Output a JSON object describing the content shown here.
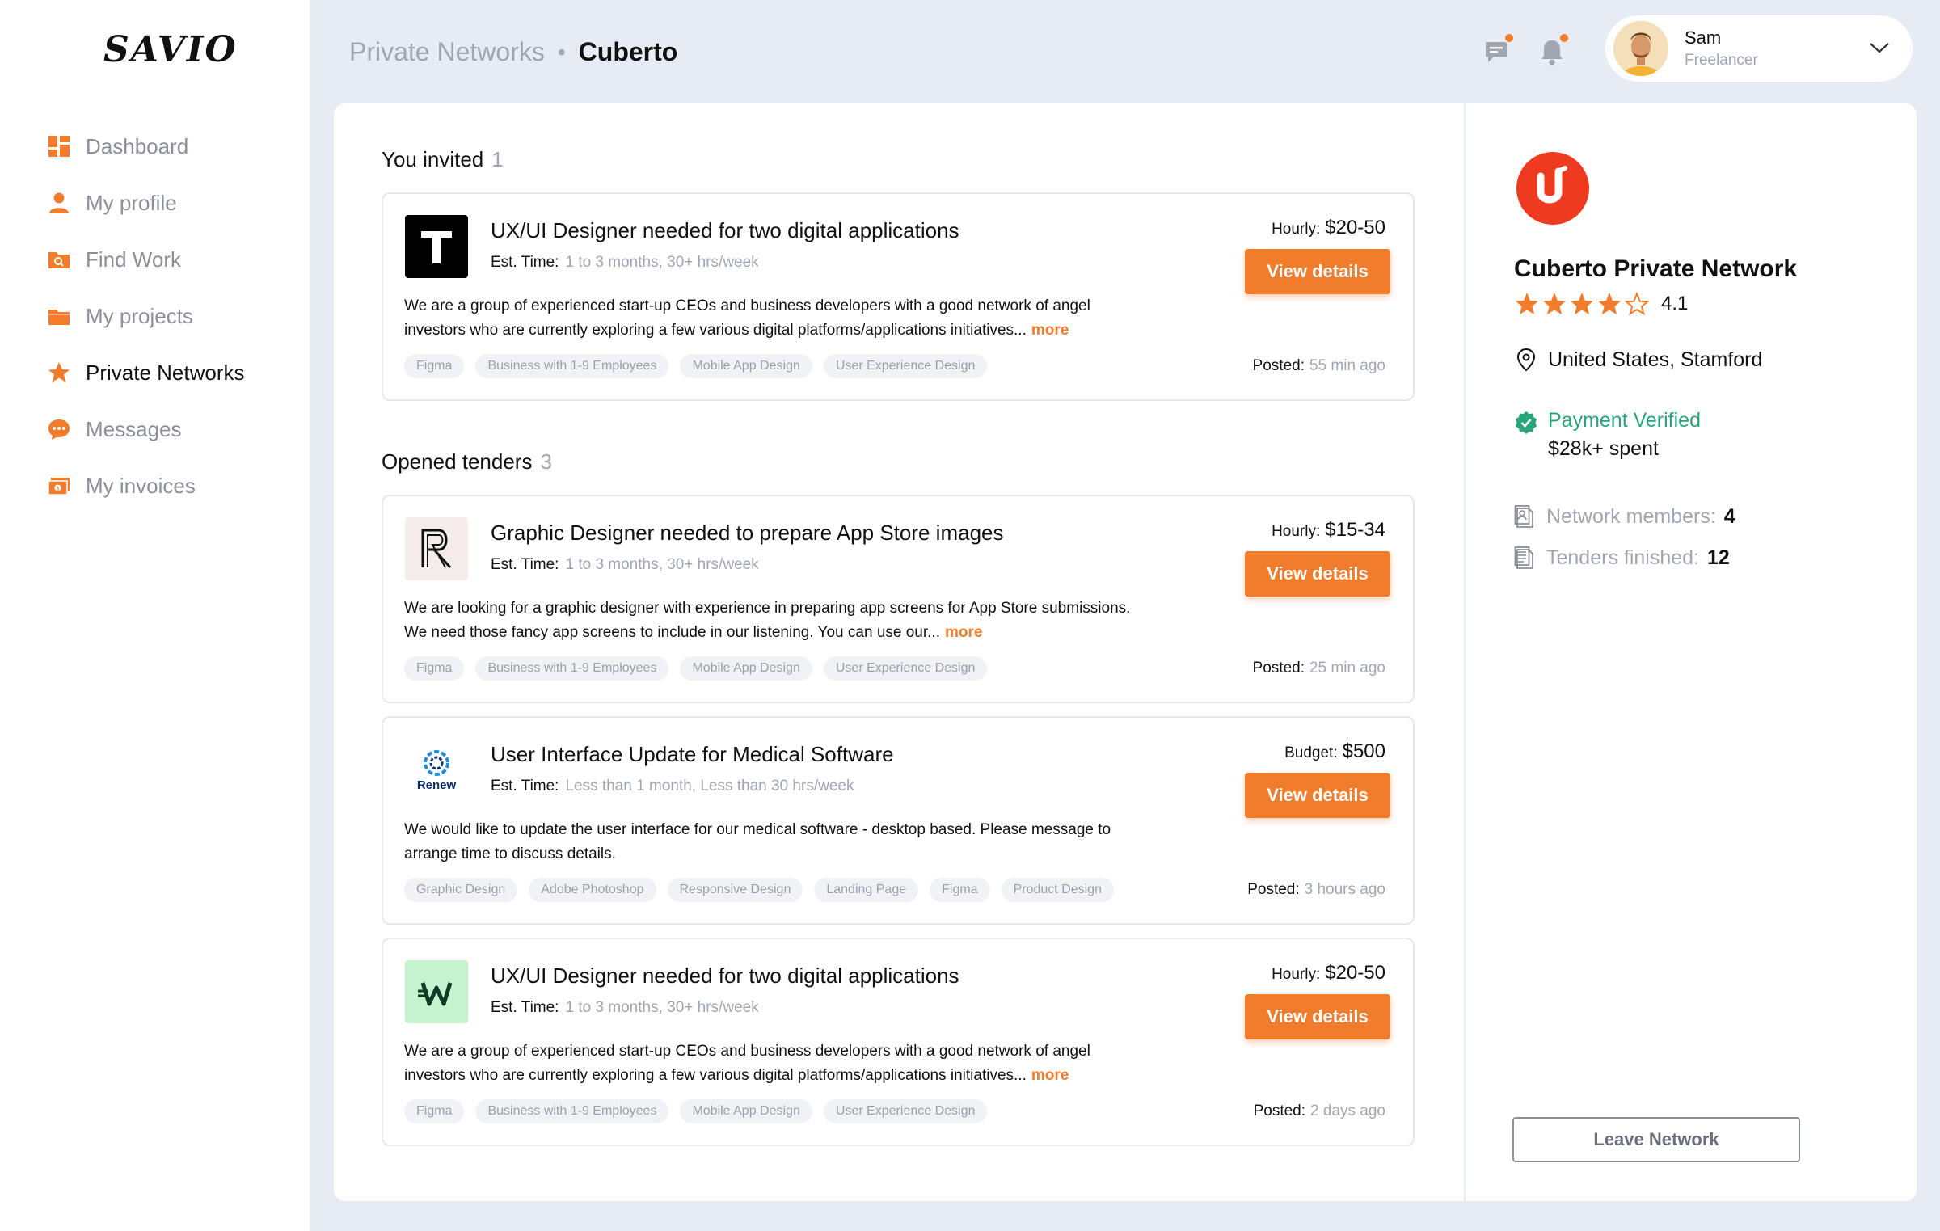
{
  "app": {
    "logo": "SAVIO"
  },
  "sidebar": {
    "items": [
      {
        "label": "Dashboard",
        "icon": "dashboard-icon",
        "active": false
      },
      {
        "label": "My profile",
        "icon": "user-icon",
        "active": false
      },
      {
        "label": "Find Work",
        "icon": "search-folder-icon",
        "active": false
      },
      {
        "label": "My projects",
        "icon": "folder-icon",
        "active": false
      },
      {
        "label": "Private Networks",
        "icon": "star-icon",
        "active": true
      },
      {
        "label": "Messages",
        "icon": "chat-icon",
        "active": false
      },
      {
        "label": "My invoices",
        "icon": "invoice-icon",
        "active": false
      }
    ]
  },
  "header": {
    "breadcrumb_parent": "Private Networks",
    "breadcrumb_sep": "•",
    "breadcrumb_current": "Cuberto",
    "user": {
      "name": "Sam",
      "role": "Freelancer"
    }
  },
  "colors": {
    "accent": "#f07c2c",
    "verified": "#2aa57a",
    "muted": "#a0a6b2",
    "background": "#e7ebf3"
  },
  "invited": {
    "title": "You invited",
    "count": "1",
    "cards": [
      {
        "title": "UX/UI Designer needed for two digital applications",
        "est_label": "Est. Time:",
        "est_value": "1 to 3 months, 30+ hrs/week",
        "desc": "We are a group of experienced start-up CEOs and business developers with a good network of angel investors who are currently exploring a few various digital platforms/applications initiatives...",
        "more": "more",
        "tags": [
          "Figma",
          "Business with 1-9 Employees",
          "Mobile App Design",
          "User Experience Design"
        ],
        "rate_label": "Hourly:",
        "rate_value": "$20-50",
        "button": "View details",
        "posted_label": "Posted:",
        "posted_value": "55 min ago"
      }
    ]
  },
  "tenders": {
    "title": "Opened tenders",
    "count": "3",
    "cards": [
      {
        "title": "Graphic Designer needed to prepare App Store images",
        "est_label": "Est. Time:",
        "est_value": "1 to 3 months, 30+ hrs/week",
        "desc": "We are looking for a graphic designer with experience in preparing app screens for App Store submissions. We need those fancy app screens to include in our listening. You can use our...",
        "more": "more",
        "tags": [
          "Figma",
          "Business with 1-9 Employees",
          "Mobile App Design",
          "User Experience Design"
        ],
        "rate_label": "Hourly:",
        "rate_value": "$15-34",
        "button": "View details",
        "posted_label": "Posted:",
        "posted_value": "25 min ago"
      },
      {
        "title": "User Interface Update for Medical Software",
        "est_label": "Est. Time:",
        "est_value": "Less than 1 month, Less than 30 hrs/week",
        "desc": "We would like to update the user interface for our medical software - desktop based. Please message to arrange time to discuss details.",
        "more": "",
        "logo_text": "Renew",
        "tags": [
          "Graphic Design",
          "Adobe Photoshop",
          "Responsive Design",
          "Landing Page",
          "Figma",
          "Product Design"
        ],
        "rate_label": "Budget:",
        "rate_value": "$500",
        "button": "View details",
        "posted_label": "Posted:",
        "posted_value": "3 hours ago"
      },
      {
        "title": "UX/UI Designer needed for two digital applications",
        "est_label": "Est. Time:",
        "est_value": "1 to 3 months, 30+ hrs/week",
        "desc": "We are a group of experienced start-up CEOs and business developers with a good network of angel investors who are currently exploring a few various digital platforms/applications initiatives...",
        "more": "more",
        "tags": [
          "Figma",
          "Business with 1-9 Employees",
          "Mobile App Design",
          "User Experience Design"
        ],
        "rate_label": "Hourly:",
        "rate_value": "$20-50",
        "button": "View details",
        "posted_label": "Posted:",
        "posted_value": "2 days ago"
      }
    ]
  },
  "network": {
    "name": "Cuberto Private Network",
    "rating": "4.1",
    "rating_stars": 4.1,
    "location": "United States, Stamford",
    "payment_verified": "Payment Verified",
    "spent": "$28k+ spent",
    "members_label": "Network members:",
    "members_value": "4",
    "tenders_label": "Tenders finished:",
    "tenders_value": "12",
    "leave_button": "Leave Network"
  }
}
